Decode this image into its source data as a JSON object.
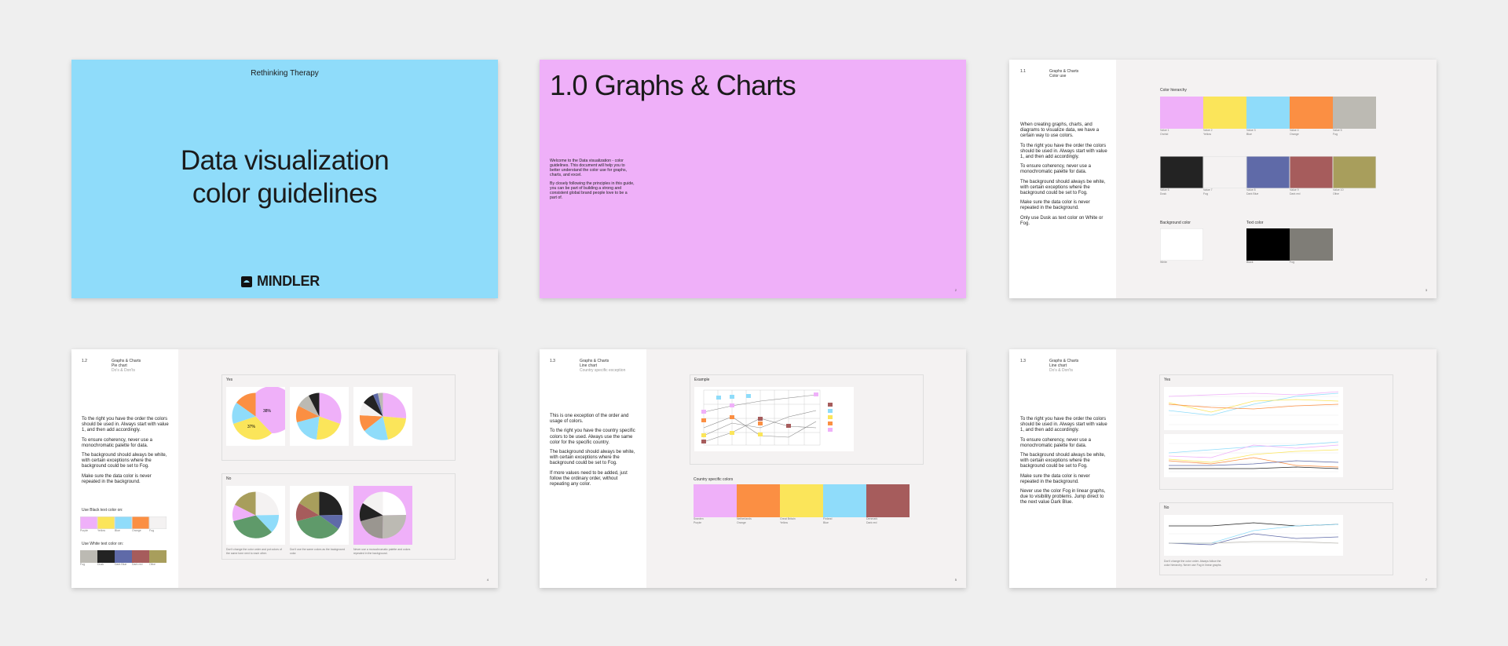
{
  "slide1": {
    "header": "Rethinking Therapy",
    "title_line1": "Data visualization",
    "title_line2": "color guidelines",
    "brand": "MINDLER",
    "bg": "#8fdcfa"
  },
  "slide2": {
    "title": "1.0 Graphs & Charts",
    "para1": "Welcome to the Data visualization - color guidelines. This document will help you to better understand the color use for graphs, charts, and excel.",
    "para2": "By closely following the principles in this guide, you can be part of building a strong and consistent global brand people love to be a part of.",
    "page": "2",
    "bg": "#efb0f9"
  },
  "slide3": {
    "num": "1.1",
    "title": "Graphs & Charts",
    "subtitle": "Color use",
    "p1": "When creating graphs, charts, and diagrams to visualize data, we have a certain way to use colors.",
    "p2": "To the right you have the order the colors should be used in. Always start with value 1, and then add accordingly.",
    "p3": "To ensure coherency, never use a monochromatic palette for data.",
    "p4": "The background should always be white, with certain exceptions where the background could be set to Fog.",
    "p5": "Make sure the data color is never repeated in the background.",
    "p6": "Only use Dusk as text color on White or Fog.",
    "hierarchy_label": "Color hierarchy",
    "background_label": "Background color",
    "text_label": "Text color",
    "row1": [
      {
        "value": "Value 1",
        "name": "Orchid",
        "color": "#efb0f9"
      },
      {
        "value": "Value 2",
        "name": "Yellow",
        "color": "#fbe55a"
      },
      {
        "value": "Value 3",
        "name": "Blue",
        "color": "#8fdcfa"
      },
      {
        "value": "Value 4",
        "name": "Orange",
        "color": "#fb8f43"
      },
      {
        "value": "Value 5",
        "name": "Fog",
        "color": "#bcbab3"
      }
    ],
    "row2": [
      {
        "value": "Value 6",
        "name": "Dusk",
        "color": "#232323"
      },
      {
        "value": "Value 7",
        "name": "Fog",
        "color": "#f4f2f2"
      },
      {
        "value": "Value 8",
        "name": "Dark Blue",
        "color": "#5f6aa8"
      },
      {
        "value": "Value 9",
        "name": "Dark red",
        "color": "#a65c5c"
      },
      {
        "value": "Value 10",
        "name": "Olive",
        "color": "#a89e5c"
      }
    ],
    "background": [
      {
        "name": "White",
        "color": "#ffffff"
      }
    ],
    "text_colors": [
      {
        "name": "Black",
        "color": "#000000"
      },
      {
        "name": "Fog",
        "color": "#7f7d77"
      }
    ],
    "page": "3"
  },
  "slide4": {
    "num": "1.2",
    "title": "Graphs & Charts",
    "subtitle": "Pie chart",
    "subtitle2": "Do's & Don'ts",
    "p1": "To the right you have the order the colors should be used in. Always start with value 1, and then add accordingly.",
    "p2": "To ensure coherency, never use a monochromatic palette for data.",
    "p3": "The background should always be white, with certain exceptions where the background could be set to Fog.",
    "p4": "Make sure the data color is never repeated in the background.",
    "black_label": "Use Black text color on:",
    "white_label": "Use White text color on:",
    "black_swatches": [
      {
        "name": "Purple",
        "color": "#efb0f9"
      },
      {
        "name": "Yellow",
        "color": "#fbe55a"
      },
      {
        "name": "Blue",
        "color": "#8fdcfa"
      },
      {
        "name": "Orange",
        "color": "#fb8f43"
      },
      {
        "name": "Fog",
        "color": "#f4f2f2"
      }
    ],
    "white_swatches": [
      {
        "name": "Fog",
        "color": "#bcbab3"
      },
      {
        "name": "Dusk",
        "color": "#232323"
      },
      {
        "name": "Dark Blue",
        "color": "#5f6aa8"
      },
      {
        "name": "Dark red",
        "color": "#a65c5c"
      },
      {
        "name": "Olive",
        "color": "#a89e5c"
      }
    ],
    "yes_label": "Yes",
    "no_label": "No",
    "pie_labels": [
      "38%",
      "37%"
    ],
    "no_caption1": "Don't change the color order and put colors of the same tone next to each other.",
    "no_caption2": "Don't use the same colors as the background color.",
    "no_caption3": "Never use a monochromatic palette and colors repeated in the background.",
    "page": "4"
  },
  "slide5": {
    "num": "1.3",
    "title": "Graphs & Charts",
    "subtitle": "Line chart",
    "subtitle2": "Country specific exception",
    "p1": "This is one exception of the order and usage of colors.",
    "p2": "To the right you have the country specific colors to be used. Always use the same color for the specific country.",
    "p3": "The background should always be white, with certain exceptions where the background could be set to Fog.",
    "p4": "If more values need to be added, just follow the ordinary order, without repeating any color.",
    "example_label": "Example",
    "country_label": "Country specific colors",
    "countries": [
      {
        "country": "Sweden",
        "name": "Purple",
        "color": "#efb0f9"
      },
      {
        "country": "Netherlands",
        "name": "Orange",
        "color": "#fb8f43"
      },
      {
        "country": "Great Britain",
        "name": "Yellow",
        "color": "#fbe55a"
      },
      {
        "country": "Finland",
        "name": "Blue",
        "color": "#8fdcfa"
      },
      {
        "country": "Denmark",
        "name": "Dark red",
        "color": "#a65c5c"
      }
    ],
    "page": "5"
  },
  "slide6": {
    "num": "1.3",
    "title": "Graphs & Charts",
    "subtitle": "Line chart",
    "subtitle2": "Do's & Don'ts",
    "p1": "To the right you have the order the colors should be used in. Always start with value 1, and then add accordingly.",
    "p2": "To ensure coherency, never use a monochromatic palette for data.",
    "p3": "The background should always be white, with certain exceptions where the background could be set to Fog.",
    "p4": "Make sure the data color is never repeated in the background.",
    "p5": "Never use the color Fog in linear graphs, due to visibility problems. Jump direct to the next value Dark Blue.",
    "yes_label": "Yes",
    "no_label": "No",
    "no_caption": "Don't change the color order. Always follow the color hierarchy. Never use Fog in linear graphs.",
    "page": "7"
  }
}
